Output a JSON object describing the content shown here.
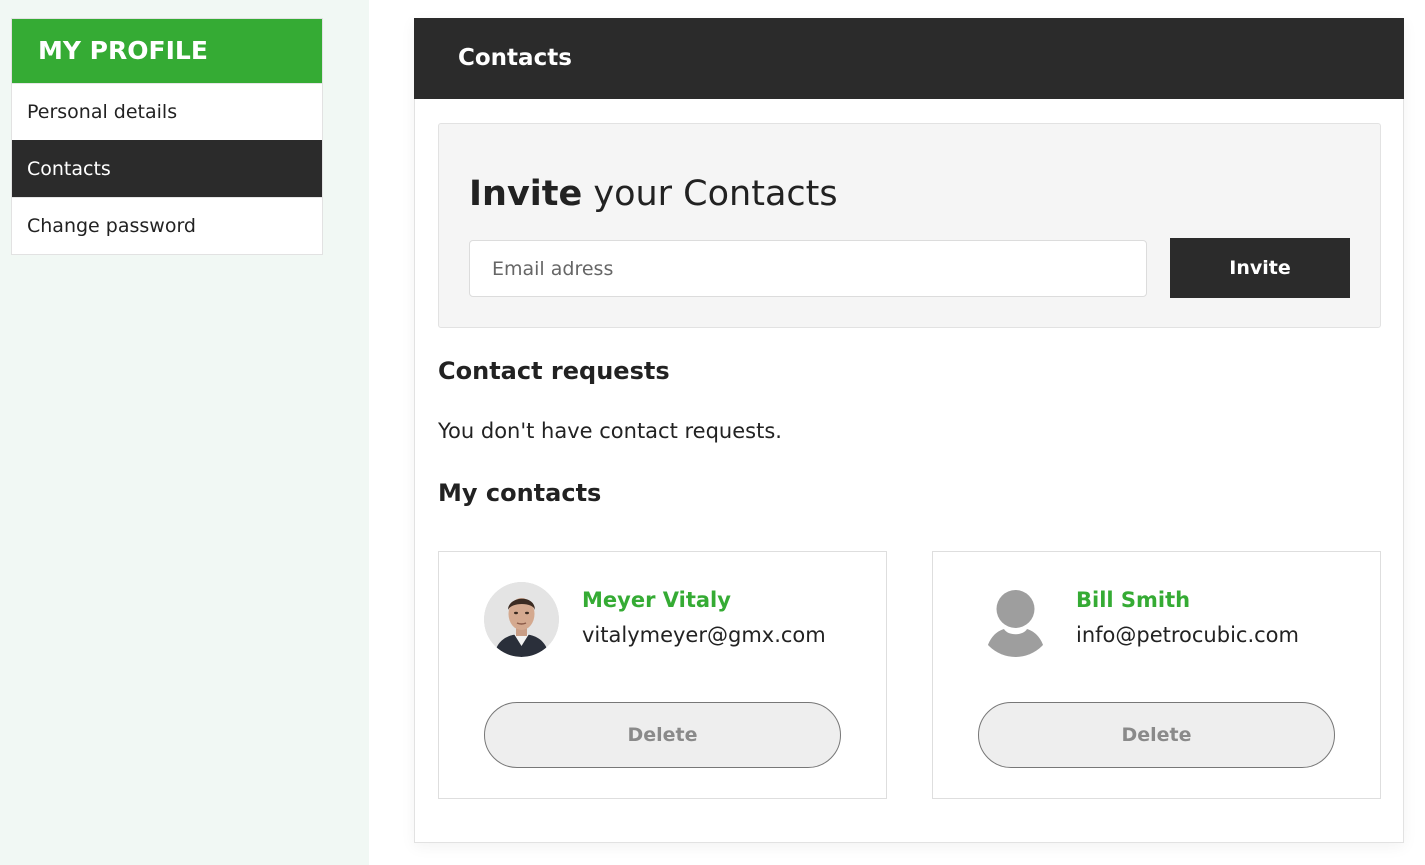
{
  "sidebar": {
    "header": "MY PROFILE",
    "items": [
      {
        "label": "Personal details",
        "active": false
      },
      {
        "label": "Contacts",
        "active": true
      },
      {
        "label": "Change password",
        "active": false
      }
    ]
  },
  "main": {
    "title": "Contacts",
    "invite": {
      "title_bold": "Invite",
      "title_rest": " your Contacts",
      "email_placeholder": "Email adress",
      "email_value": "",
      "button_label": "Invite"
    },
    "requests": {
      "title": "Contact requests",
      "empty_text": "You don't have contact requests."
    },
    "my_contacts": {
      "title": "My contacts",
      "items": [
        {
          "name": "Meyer Vitaly",
          "email": "vitalymeyer@gmx.com",
          "avatar": "photo",
          "delete_label": "Delete"
        },
        {
          "name": "Bill Smith",
          "email": "info@petrocubic.com",
          "avatar": "default-user-icon",
          "delete_label": "Delete"
        }
      ]
    }
  },
  "colors": {
    "accent_green": "#35ab34",
    "dark": "#2b2b2b",
    "sidebar_bg": "#f1f8f4"
  }
}
